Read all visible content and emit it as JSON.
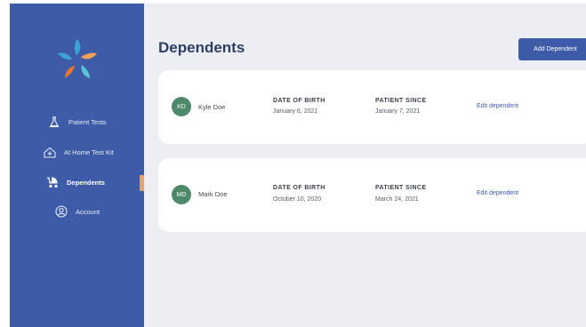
{
  "brand": {
    "logo_colors": [
      "#3aa5d8",
      "#f3a15a",
      "#5cc3d1",
      "#e8762d"
    ]
  },
  "sidebar": {
    "items": [
      {
        "label": "Patient Tests",
        "icon": "flask-icon",
        "active": false
      },
      {
        "label": "At Home Test Kit",
        "icon": "home-plus-icon",
        "active": false
      },
      {
        "label": "Dependents",
        "icon": "stroller-icon",
        "active": true
      },
      {
        "label": "Account",
        "icon": "user-circle-icon",
        "active": false
      }
    ]
  },
  "header": {
    "title": "Dependents",
    "add_button_label": "Add Dependent"
  },
  "dependents": [
    {
      "initials": "KD",
      "name": "Kyle Doe",
      "dob_label": "DATE OF BIRTH",
      "dob": "January 6, 2021",
      "patient_since_label": "PATIENT SINCE",
      "patient_since": "January 7, 2021",
      "edit_label": "Edit dependent"
    },
    {
      "initials": "MD",
      "name": "Mark Doe",
      "dob_label": "DATE OF BIRTH",
      "dob": "October 10, 2020",
      "patient_since_label": "PATIENT SINCE",
      "patient_since": "March 24, 2021",
      "edit_label": "Edit dependent"
    }
  ],
  "colors": {
    "sidebar": "#3d5ba6",
    "accent": "#3d5ba6",
    "avatar": "#4e8a69",
    "active_marker": "#e8a06a"
  }
}
